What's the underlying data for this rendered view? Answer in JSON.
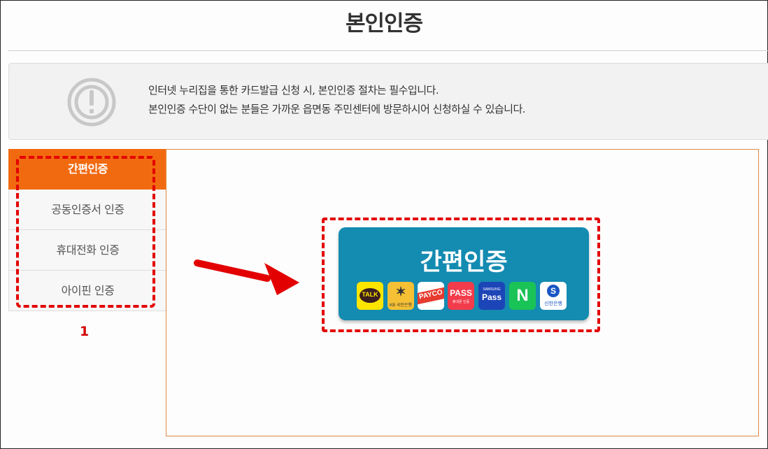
{
  "page": {
    "title": "본인인증"
  },
  "notice": {
    "icon": "alert-circle-icon",
    "line1": "인터넷 누리집을 통한 카드발급 신청 시, 본인인증 절차는 필수입니다.",
    "line2": "본인인증 수단이 없는 분들은 가까운 읍면동 주민센터에 방문하시어 신청하실 수 있습니다."
  },
  "tabs": [
    {
      "label": "간편인증",
      "active": true
    },
    {
      "label": "공동인증서 인증",
      "active": false
    },
    {
      "label": "휴대전화 인증",
      "active": false
    },
    {
      "label": "아이핀 인증",
      "active": false
    }
  ],
  "annotation": {
    "step_number": "1",
    "arrow_icon": "red-arrow-icon"
  },
  "easy_auth": {
    "button_label": "간편인증",
    "providers": [
      {
        "name": "kakao-icon",
        "label": "TALK"
      },
      {
        "name": "kb-icon",
        "label": "KB 국민은행"
      },
      {
        "name": "payco-icon",
        "label": "PAYCO"
      },
      {
        "name": "pass-icon",
        "label": "PASS"
      },
      {
        "name": "samsung-pass-icon",
        "label": "Pass"
      },
      {
        "name": "naver-icon",
        "label": "N"
      },
      {
        "name": "shinhan-icon",
        "label": "신한은행"
      }
    ]
  },
  "colors": {
    "active_tab": "#f26a10",
    "button": "#148bb1",
    "annotation": "#e30000",
    "panel_border": "#e3883f"
  }
}
